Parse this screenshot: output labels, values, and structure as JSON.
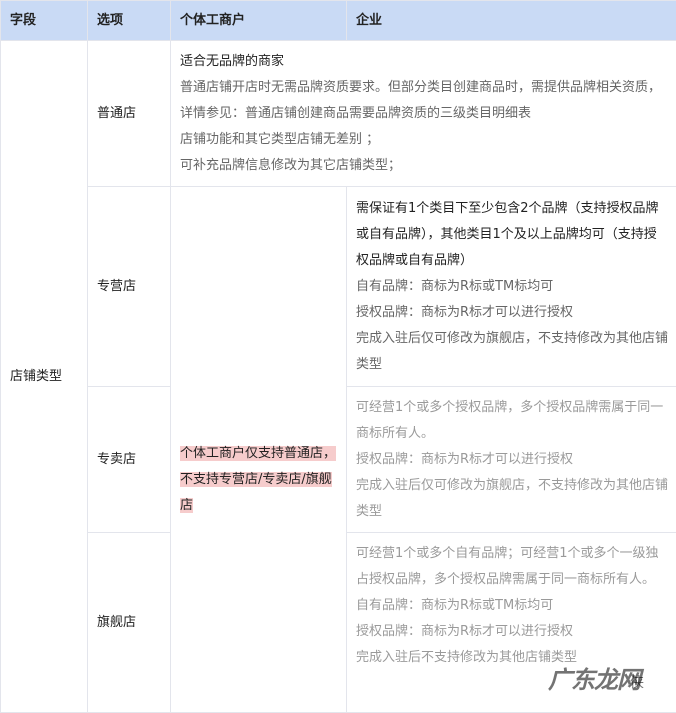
{
  "header": {
    "field": "字段",
    "option": "选项",
    "individual": "个体工商户",
    "enterprise": "企业"
  },
  "field_label": "店铺类型",
  "rows": [
    {
      "option": "普通店",
      "lines": [
        "适合无品牌的商家",
        "普通店铺开店时无需品牌资质要求。但部分类目创建商品时，需提供品牌相关资质，详情参见：普通店铺创建商品需要品牌资质的三级类目明细表",
        "店铺功能和其它类型店铺无差别 ；",
        "可补充品牌信息修改为其它店铺类型；"
      ]
    },
    {
      "option": "专营店",
      "lines": [
        "需保证有1个类目下至少包含2个品牌（支持授权品牌或自有品牌），其他类目1个及以上品牌均可（支持授权品牌或自有品牌）",
        "自有品牌：商标为R标或TM标均可",
        "授权品牌：商标为R标才可以进行授权",
        "完成入驻后仅可修改为旗舰店，不支持修改为其他店铺类型"
      ]
    },
    {
      "option": "专卖店",
      "lines": [
        "可经营1个或多个授权品牌，多个授权品牌需属于同一商标所有人。",
        "授权品牌：商标为R标才可以进行授权",
        "完成入驻后仅可修改为旗舰店，不支持修改为其他店铺类型"
      ]
    },
    {
      "option": "旗舰店",
      "lines": [
        "可经营1个或多个自有品牌；可经营1个或多个一级独占授权品牌，多个授权品牌需属于同一商标所有人。",
        "自有品牌：商标为R标或TM标均可",
        "授权品牌：商标为R标才可以进行授权",
        "完成入驻后不支持修改为其他店铺类型"
      ]
    }
  ],
  "individual_note": "个体工商户仅支持普通店，不支持专营店/专卖店/旗舰店",
  "watermark": "广东龙网",
  "watermark_suffix": "侠"
}
